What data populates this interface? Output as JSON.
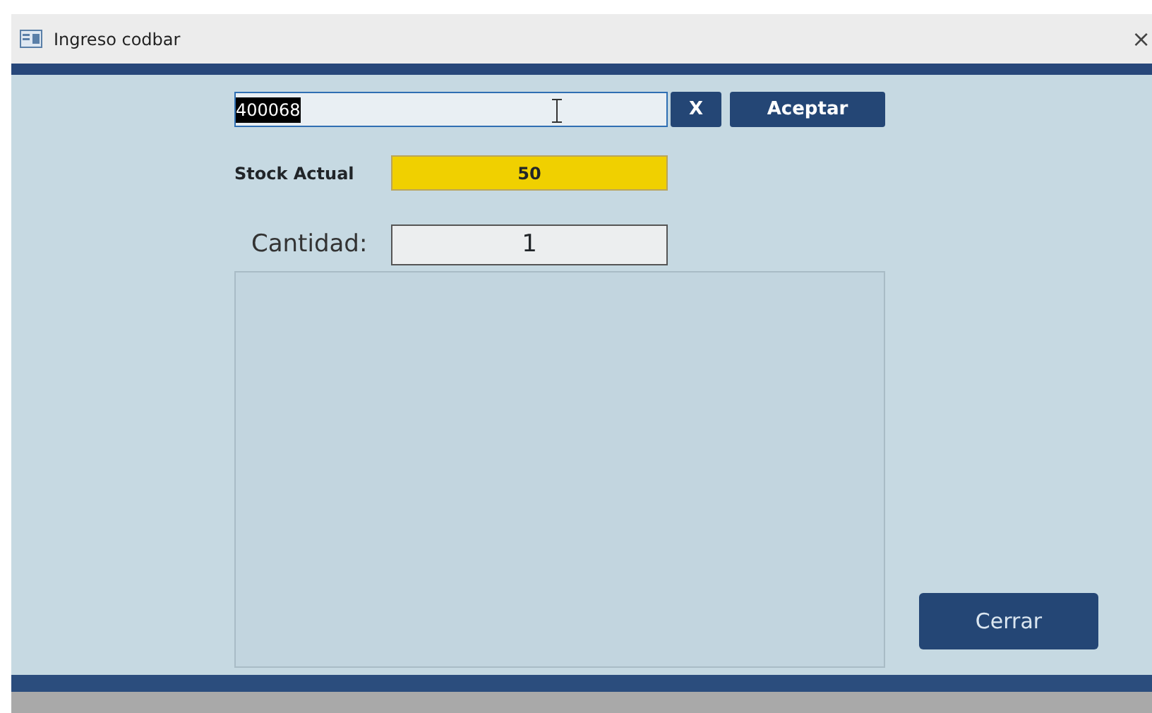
{
  "window": {
    "title": "Ingreso codbar",
    "close": "×"
  },
  "code_field": {
    "value": "400068",
    "text_selected": true
  },
  "clear_button": "X",
  "accept_button": "Aceptar",
  "stock": {
    "label": "Stock Actual",
    "value": "50"
  },
  "quantity": {
    "label": "Cantidad:",
    "value": "1"
  },
  "close_button": "Cerrar"
}
